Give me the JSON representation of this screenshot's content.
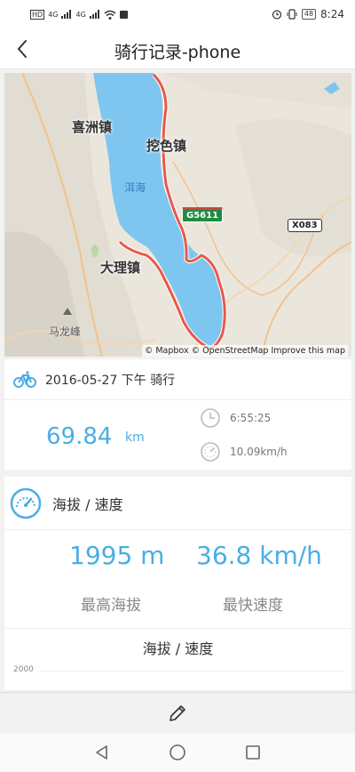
{
  "status_bar": {
    "left_icons": [
      "HD",
      "4G",
      "4G"
    ],
    "battery": "48",
    "time": "8:24",
    "icons": [
      "signal-icon",
      "wifi-icon",
      "alarm-icon",
      "vibrate-icon",
      "battery-icon"
    ]
  },
  "header": {
    "title": "骑行记录-phone"
  },
  "map": {
    "labels": {
      "xizhou": "喜洲镇",
      "wase": "挖色镇",
      "dali": "大理镇",
      "erhai": "洱海",
      "malong": "马龙峰"
    },
    "shields": {
      "g5611": "G5611",
      "x083": "X083"
    },
    "attribution": {
      "mapbox": "© Mapbox",
      "osm": "© OpenStreetMap",
      "improve": "Improve this map"
    },
    "colors": {
      "water": "#7ec6f0",
      "route": "#e8584a",
      "land": "#ebe6dc"
    }
  },
  "ride": {
    "title": "2016-05-27 下午 骑行",
    "distance": "69.84",
    "distance_unit": "km",
    "duration": "6:55:25",
    "avg_speed": "10.09km/h"
  },
  "altitude": {
    "section_title": "海拔 / 速度",
    "max_altitude": "1995 m",
    "max_altitude_label": "最高海拔",
    "max_speed": "36.8 km/h",
    "max_speed_label": "最快速度",
    "chart_title": "海拔 / 速度",
    "y_tick_top": "2000"
  },
  "colors": {
    "accent": "#4aaee6"
  }
}
